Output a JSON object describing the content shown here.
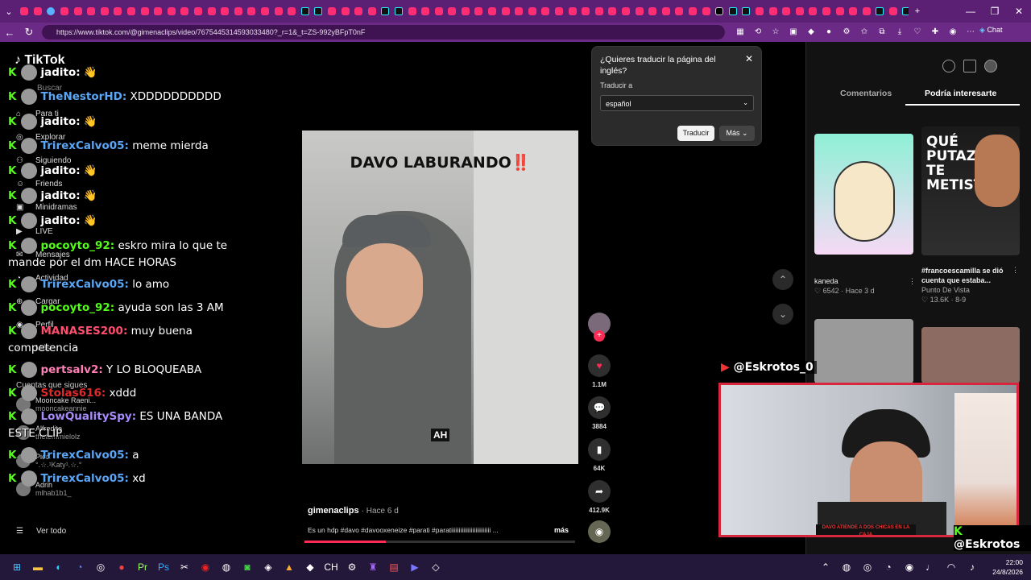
{
  "browser": {
    "tab_count": 68,
    "url": "https://www.tiktok.com/@gimenaclips/video/7675445314593033480?_r=1&_t=ZS-992yBFpT0nF",
    "chat_label": "Chat"
  },
  "tiktok": {
    "logo": "TikTok",
    "search_placeholder": "Buscar",
    "nav": [
      "Para ti",
      "Explorar",
      "Siguiendo",
      "Friends",
      "Minidramas",
      "LIVE",
      "Mensajes",
      "Actividad",
      "Cargar",
      "Perfil",
      "Más"
    ],
    "following_header": "Cuentas que sigues",
    "following": [
      {
        "name": "Mooncake Raeni...",
        "handle": "mooncakeannie"
      },
      {
        "name": "Alfredito",
        "handle": "thetemmielolz"
      },
      {
        "name": "Picci",
        "handle": "°.☆.¹Katy¹.☆.°"
      },
      {
        "name": "Adrih",
        "handle": "mlhab1b1_"
      }
    ],
    "see_all": "Ver todo"
  },
  "chat": {
    "badge": "K",
    "messages": [
      {
        "user": "jadito:",
        "text": "👋",
        "color": "#ffffff"
      },
      {
        "user": "TheNestorHD:",
        "text": "XDDDDDDDDDD",
        "color": "#5aa6f5"
      },
      {
        "user": "jadito:",
        "text": "👋",
        "color": "#ffffff"
      },
      {
        "user": "TrirexCalvo05:",
        "text": "meme mierda",
        "color": "#5aa6f5"
      },
      {
        "user": "jadito:",
        "text": "👋",
        "color": "#ffffff"
      },
      {
        "user": "jadito:",
        "text": "👋",
        "color": "#ffffff"
      },
      {
        "user": "jadito:",
        "text": "👋",
        "color": "#ffffff"
      },
      {
        "user": "pocoyto_92:",
        "text": "eskro mira lo que te mande por el dm HACE HORAS",
        "color": "#53fc18"
      },
      {
        "user": "TrirexCalvo05:",
        "text": "lo amo",
        "color": "#5aa6f5"
      },
      {
        "user": "pocoyto_92:",
        "text": "ayuda son las 3 AM",
        "color": "#53fc18"
      },
      {
        "user": "MANASES200:",
        "text": "muy buena competencia",
        "color": "#ff4d6d"
      },
      {
        "user": "pertsalv2:",
        "text": "Y LO BLOQUEABA",
        "color": "#ff7eb6"
      },
      {
        "user": "Stolas616:",
        "text": "xddd",
        "color": "#e02a2a"
      },
      {
        "user": "LowQualitySpy:",
        "text": "ES UNA BANDA ESTE CLIP",
        "color": "#a78bfa"
      },
      {
        "user": "TrirexCalvo05:",
        "text": "a",
        "color": "#5aa6f5"
      },
      {
        "user": "TrirexCalvo05:",
        "text": "xd",
        "color": "#5aa6f5"
      }
    ]
  },
  "video": {
    "title": "DAVO LABURANDO",
    "title_mark": "‼️",
    "caption": "AH",
    "author": "gimenaclips",
    "posted": "· Hace 6 d",
    "description": "Es un hdp #davo #davooxeneize #parati #paratiiiiiiiiiiiiiiiiiiiiiiiiii ...",
    "more": "más",
    "progress": 0.3,
    "likes": "1.1M",
    "comments": "3884",
    "saves": "64K",
    "shares": "412.9K"
  },
  "translate": {
    "question": "¿Quieres traducir la página del inglés?",
    "translate_to": "Traducir a",
    "language": "español",
    "translate_button": "Traducir",
    "more_button": "Más"
  },
  "right_panel": {
    "tab_comments": "Comentarios",
    "tab_interest": "Podría interesarte",
    "items": [
      {
        "title": "kaneda",
        "stats": "♡ 6542 · Hace 3 d",
        "creator": ""
      },
      {
        "title": "#francoescamilla se dió cuenta que estaba...",
        "stats": "♡ 13.6K · 8-9",
        "creator": "Punto De Vista"
      }
    ],
    "thumb2_text": "QUÉ PUTAZO TE METISTE"
  },
  "stream": {
    "handle_top": "@Eskrotos_0",
    "handle_bottom": "@Eskrotos",
    "banner": "DAVO ATIENDE A DOS CHICAS EN LA CAJA"
  },
  "taskbar": {
    "time": "22:00",
    "date": "24/8/2026"
  }
}
